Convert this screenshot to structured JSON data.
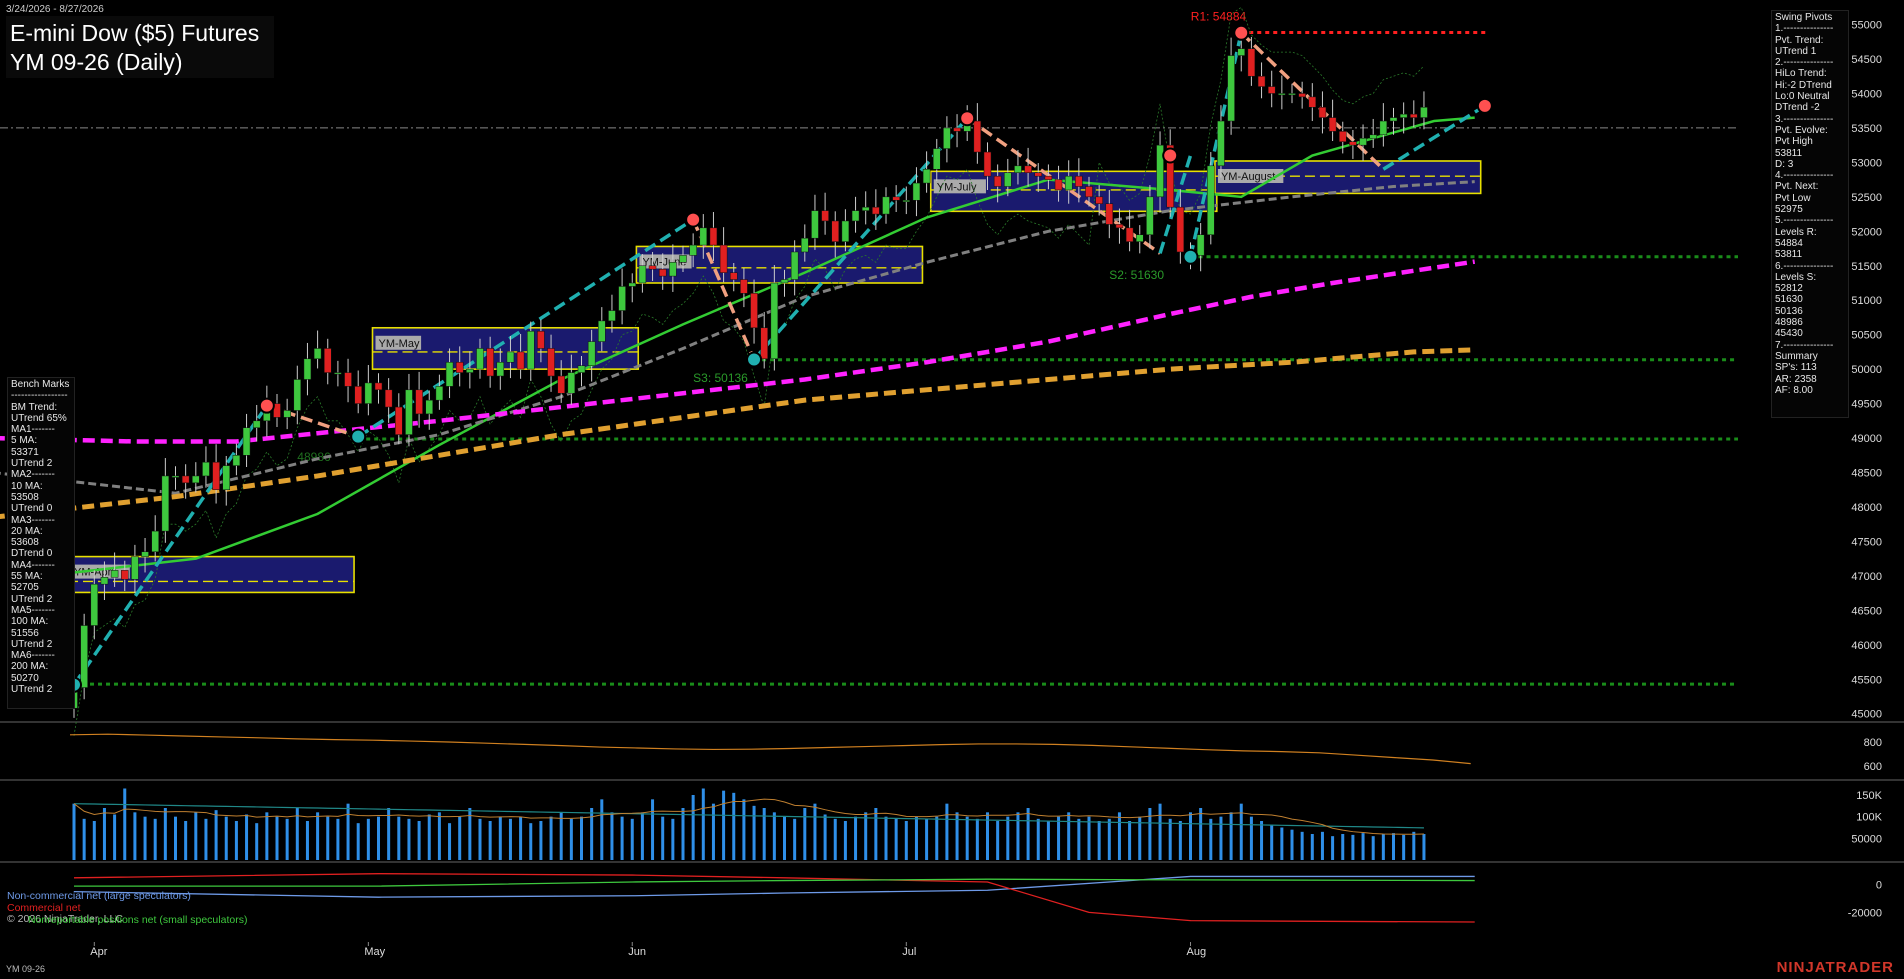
{
  "header": {
    "date_range": "3/24/2026 - 8/27/2026",
    "title": "E-mini Dow ($5) Futures",
    "subtitle": "YM 09-26 (Daily)"
  },
  "footer": {
    "symbol": "YM 09-26",
    "brand": "NINJATRADER"
  },
  "colors": {
    "background": "#000000",
    "up_candle": "#3ec83e",
    "down_candle": "#e02020",
    "ma_green": "#33cc33",
    "ma_gray": "#808080",
    "ma_magenta": "#ff22ff",
    "ma_orange": "#e0a030",
    "swing_up": "#20b0b0",
    "swing_down": "#f0a080",
    "resistance": "#ff2020",
    "support": "#1a8c1a",
    "volume": "#2f8fe8",
    "value_area": "#1a1a6e",
    "value_area_border": "#e8e000"
  },
  "swing_pivots": {
    "lines": [
      "Swing Pivots",
      "1.---------------",
      "Pvt. Trend:",
      "UTrend 1",
      "2.---------------",
      "HiLo Trend:",
      "Hi:-2 DTrend",
      "Lo:0 Neutral",
      "DTrend -2",
      "3.---------------",
      "Pvt. Evolve:",
      "Pvt High",
      "53811",
      "D: 3",
      "4.---------------",
      "Pvt. Next:",
      "Pvt Low",
      "52975",
      "5.---------------",
      "Levels R:",
      "54884",
      "53811",
      "6.---------------",
      "Levels S:",
      "52812",
      "51630",
      "50136",
      "48986",
      "45430",
      "7.---------------",
      "Summary",
      "SP's: 113",
      "AR: 2358",
      "AF: 8.00"
    ]
  },
  "bench_marks": {
    "lines": [
      "Bench Marks",
      "-----------------",
      "BM Trend:",
      "UTrend 65%",
      "MA1-------",
      "5 MA:",
      "53371",
      "UTrend 2",
      "MA2-------",
      "10 MA:",
      "53508",
      "UTrend 0",
      "MA3-------",
      "20 MA:",
      "53608",
      "DTrend 0",
      "MA4-------",
      "55 MA:",
      "52705",
      "UTrend 2",
      "MA5-------",
      "100 MA:",
      "51556",
      "UTrend 2",
      "MA6-------",
      "200 MA:",
      "50270",
      "UTrend 2"
    ]
  },
  "cot_legend": {
    "noncommercial": "Non-commercial net (large speculators)",
    "commercial": "Commercial net",
    "copyright": "© 2026 NinjaTrader, LLC",
    "nonreportable": "Nonreportable positions net (small speculators)"
  },
  "chart_data": {
    "type": "candlestick",
    "title": "YM 09-26 (Daily)",
    "x_labels": [
      "Apr",
      "May",
      "Jun",
      "Jul",
      "Aug"
    ],
    "y_ticks": [
      45000,
      45500,
      46000,
      46500,
      47000,
      47500,
      48000,
      48500,
      49000,
      49500,
      50000,
      50500,
      51000,
      51500,
      52000,
      52500,
      53000,
      53500,
      54000,
      54500,
      55000
    ],
    "ylim": [
      44880,
      55240
    ],
    "closes": [
      45380,
      46280,
      46880,
      46980,
      47080,
      46950,
      47280,
      47350,
      47650,
      48450,
      48450,
      48350,
      48450,
      48650,
      48250,
      48600,
      48750,
      49150,
      49250,
      49500,
      49300,
      49400,
      49850,
      50150,
      50300,
      49950,
      49950,
      49750,
      49500,
      49800,
      49700,
      49450,
      49050,
      49700,
      49350,
      49550,
      49750,
      50100,
      49950,
      50000,
      50300,
      49900,
      50100,
      50250,
      50000,
      50550,
      50300,
      49900,
      49650,
      49950,
      50050,
      50400,
      50700,
      50850,
      51200,
      51250,
      51500,
      51450,
      51350,
      51550,
      51650,
      51800,
      52050,
      51800,
      51400,
      51300,
      51100,
      50600,
      50150,
      51250,
      51300,
      51700,
      51900,
      52300,
      52150,
      51850,
      52150,
      52300,
      52350,
      52250,
      52500,
      52450,
      52450,
      52700,
      52900,
      53200,
      53500,
      53450,
      53600,
      53150,
      52800,
      52650,
      52850,
      52950,
      52850,
      52800,
      52750,
      52600,
      52800,
      52650,
      52500,
      52400,
      52100,
      52050,
      51850,
      51950,
      52500,
      53250,
      52350,
      51700,
      51650,
      51950,
      52950,
      53600,
      54550,
      54650,
      54250,
      54100,
      54000,
      54000,
      54000,
      53950,
      53800,
      53650,
      53450,
      53300,
      53250,
      53350,
      53400,
      53600,
      53650,
      53700,
      53650,
      53800
    ],
    "levels": {
      "R1": {
        "label": "R1: 54884",
        "value": 54884
      },
      "S2": {
        "label": "S2: 51630",
        "value": 51630
      },
      "S3": {
        "label": "S3: 50136",
        "value": 50136
      },
      "S_low": {
        "label": "48986",
        "value": 48986
      },
      "S_base": {
        "value": 45430
      }
    },
    "moving_averages": [
      {
        "name": "20 MA",
        "color": "#33cc33",
        "points": [
          [
            0,
            47050
          ],
          [
            12,
            47250
          ],
          [
            24,
            47900
          ],
          [
            36,
            48900
          ],
          [
            48,
            49850
          ],
          [
            60,
            50650
          ],
          [
            72,
            51400
          ],
          [
            84,
            52200
          ],
          [
            96,
            52750
          ],
          [
            108,
            52600
          ],
          [
            115,
            52500
          ],
          [
            122,
            53100
          ],
          [
            134,
            53600
          ],
          [
            138,
            53650
          ]
        ]
      },
      {
        "name": "55 MA",
        "color": "#808080",
        "points": [
          [
            -8,
            48500
          ],
          [
            10,
            48200
          ],
          [
            24,
            48700
          ],
          [
            36,
            49050
          ],
          [
            48,
            49600
          ],
          [
            60,
            50300
          ],
          [
            72,
            51050
          ],
          [
            84,
            51550
          ],
          [
            96,
            52000
          ],
          [
            108,
            52300
          ],
          [
            120,
            52500
          ],
          [
            130,
            52650
          ],
          [
            138,
            52720
          ]
        ]
      },
      {
        "name": "100 MA",
        "color": "#ff22ff",
        "points": [
          [
            -8,
            49000
          ],
          [
            6,
            48950
          ],
          [
            16,
            48950
          ],
          [
            26,
            49100
          ],
          [
            36,
            49250
          ],
          [
            48,
            49450
          ],
          [
            60,
            49650
          ],
          [
            72,
            49850
          ],
          [
            84,
            50100
          ],
          [
            96,
            50400
          ],
          [
            108,
            50800
          ],
          [
            116,
            51050
          ],
          [
            124,
            51250
          ],
          [
            138,
            51560
          ]
        ]
      },
      {
        "name": "200 MA",
        "color": "#e0a030",
        "points": [
          [
            -8,
            47850
          ],
          [
            10,
            48150
          ],
          [
            24,
            48450
          ],
          [
            36,
            48750
          ],
          [
            48,
            49050
          ],
          [
            60,
            49300
          ],
          [
            72,
            49550
          ],
          [
            84,
            49700
          ],
          [
            96,
            49850
          ],
          [
            108,
            50000
          ],
          [
            120,
            50100
          ],
          [
            132,
            50250
          ],
          [
            138,
            50280
          ]
        ]
      }
    ],
    "value_areas": [
      {
        "label": "YM-April",
        "idx_range": [
          0,
          27
        ],
        "value_range": [
          46760,
          47280
        ],
        "poc": 46920
      },
      {
        "label": "YM-May",
        "idx_range": [
          30,
          55
        ],
        "value_range": [
          50000,
          50600
        ],
        "poc": 50250
      },
      {
        "label": "YM-June",
        "idx_range": [
          56,
          83
        ],
        "value_range": [
          51250,
          51780
        ],
        "poc": 51470
      },
      {
        "label": "YM-July",
        "idx_range": [
          85,
          112
        ],
        "value_range": [
          52290,
          52870
        ],
        "poc": 52600
      },
      {
        "label": "YM-August",
        "idx_range": [
          113,
          138
        ],
        "value_range": [
          52550,
          53020
        ],
        "poc": 52800
      }
    ],
    "swing_lines": [
      {
        "color": "#20b0b0",
        "points": [
          [
            0,
            45420
          ],
          [
            19,
            49470
          ]
        ]
      },
      {
        "color": "#f0a080",
        "points": [
          [
            19,
            49470
          ],
          [
            28,
            49020
          ]
        ]
      },
      {
        "color": "#20b0b0",
        "points": [
          [
            28,
            49020
          ],
          [
            61,
            52170
          ]
        ]
      },
      {
        "color": "#f0a080",
        "points": [
          [
            61,
            52170
          ],
          [
            67,
            50140
          ]
        ]
      },
      {
        "color": "#20b0b0",
        "points": [
          [
            67,
            50140
          ],
          [
            88,
            53640
          ]
        ]
      },
      {
        "color": "#f0a080",
        "points": [
          [
            88,
            53640
          ],
          [
            107,
            51680
          ]
        ]
      },
      {
        "color": "#20b0b0",
        "points": [
          [
            107,
            51680
          ],
          [
            110,
            53100
          ]
        ]
      },
      {
        "color": "#20b0b0",
        "points": [
          [
            110,
            51630
          ],
          [
            115,
            54880
          ]
        ]
      },
      {
        "color": "#f0a080",
        "points": [
          [
            115,
            54880
          ],
          [
            129,
            52900
          ]
        ]
      },
      {
        "color": "#20b0b0",
        "points": [
          [
            129,
            52900
          ],
          [
            139,
            53820
          ]
        ]
      }
    ],
    "stdev": {
      "ylim": [
        500,
        950
      ],
      "y_ticks": [
        600,
        800
      ],
      "color": "#d08020",
      "values": [
        860,
        865,
        858,
        850,
        842,
        835,
        826,
        820,
        815,
        808,
        800,
        790,
        780,
        770,
        758,
        750,
        742,
        738,
        740,
        746,
        754,
        762,
        770,
        778,
        784,
        784,
        780,
        772,
        760,
        748,
        736,
        726,
        720,
        710,
        690,
        670,
        650,
        620
      ]
    },
    "volume": {
      "ylim": [
        0,
        180000
      ],
      "y_ticks": [
        50000,
        100000,
        150000
      ],
      "y_tick_labels": [
        "50000",
        "100K",
        "150K"
      ],
      "values": [
        130000,
        95000,
        90000,
        120000,
        105000,
        165000,
        110000,
        100000,
        95000,
        120000,
        100000,
        90000,
        110000,
        95000,
        115000,
        100000,
        90000,
        105000,
        85000,
        110000,
        100000,
        95000,
        120000,
        90000,
        110000,
        100000,
        95000,
        130000,
        85000,
        95000,
        100000,
        120000,
        100000,
        95000,
        90000,
        105000,
        110000,
        85000,
        100000,
        120000,
        95000,
        90000,
        100000,
        95000,
        100000,
        85000,
        90000,
        100000,
        110000,
        95000,
        100000,
        120000,
        140000,
        110000,
        100000,
        95000,
        110000,
        140000,
        100000,
        95000,
        120000,
        150000,
        165000,
        130000,
        160000,
        155000,
        140000,
        125000,
        120000,
        110000,
        100000,
        95000,
        120000,
        130000,
        105000,
        95000,
        90000,
        100000,
        110000,
        120000,
        100000,
        95000,
        90000,
        100000,
        95000,
        100000,
        130000,
        110000,
        100000,
        95000,
        110000,
        90000,
        100000,
        110000,
        120000,
        95000,
        90000,
        100000,
        110000,
        95000,
        100000,
        90000,
        95000,
        110000,
        90000,
        100000,
        120000,
        130000,
        95000,
        90000,
        110000,
        120000,
        95000,
        100000,
        110000,
        130000,
        100000,
        90000,
        80000,
        75000,
        70000,
        65000,
        60000,
        65000,
        55000,
        60000,
        58000,
        62000,
        55000,
        60000,
        62000,
        58000,
        65000,
        60000,
        62000,
        55000,
        50000,
        45000,
        40000,
        10000
      ]
    },
    "cot": {
      "ylim": [
        -40000,
        15000
      ],
      "y_ticks": [
        0,
        -20000
      ],
      "y_tick_labels": [
        "0",
        "-20000"
      ],
      "noncommercial": [
        [
          0,
          -5000
        ],
        [
          30,
          -9000
        ],
        [
          55,
          -8000
        ],
        [
          70,
          -6000
        ],
        [
          90,
          -4000
        ],
        [
          110,
          6000
        ],
        [
          138,
          6000
        ]
      ],
      "commercial": [
        [
          0,
          5000
        ],
        [
          30,
          8000
        ],
        [
          55,
          7000
        ],
        [
          70,
          5000
        ],
        [
          90,
          2000
        ],
        [
          100,
          -20000
        ],
        [
          110,
          -26000
        ],
        [
          138,
          -27000
        ]
      ],
      "nonreportable": [
        [
          0,
          -1000
        ],
        [
          30,
          -1000
        ],
        [
          55,
          2000
        ],
        [
          70,
          3000
        ],
        [
          90,
          4000
        ],
        [
          110,
          3500
        ],
        [
          138,
          3000
        ]
      ]
    }
  }
}
